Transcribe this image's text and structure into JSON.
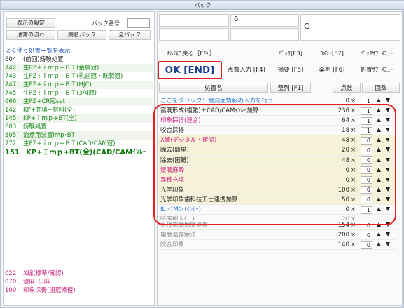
{
  "window": {
    "title": "パック"
  },
  "left": {
    "buttons": {
      "display_settings": "表示の設定",
      "pack_number_label": "パック番号",
      "normal_flow": "通常の流れ",
      "disease_pack": "病名パック",
      "all_pack": "全パック"
    },
    "list_header": "よく使う処置一覧を表示",
    "items": [
      {
        "code": "604",
        "label": "(前回)鋳験処置",
        "style": "black"
      },
      {
        "code": "742",
        "label": "生PZ+ｉｍｐ+ＢＴ(金属冠)",
        "style": "green"
      },
      {
        "code": "743",
        "label": "生PZ+ｉｍｐ+ＢＴ(乳歯冠・既製冠)",
        "style": "green"
      },
      {
        "code": "747",
        "label": "生PZ+ｉｍｐ+ＢＴ(HJC)",
        "style": "green"
      },
      {
        "code": "745",
        "label": "生PZ+ｉｍｐ+ＢＴ(3/4冠)",
        "style": "green"
      },
      {
        "code": "666",
        "label": "生PZ+CR冠set",
        "style": "green"
      },
      {
        "code": "142",
        "label": "KP+充填+材料(全)",
        "style": "green"
      },
      {
        "code": "145",
        "label": "KP+ｉｍｐ+BT(全)",
        "style": "green"
      },
      {
        "code": "603",
        "label": "鋳験処置",
        "style": "green"
      },
      {
        "code": "305",
        "label": "治療用装置imp･BT",
        "style": "green"
      },
      {
        "code": "772",
        "label": "生PZ+ｉｍｐ+ＢＴ(CAD/CAM冠)",
        "style": "green"
      },
      {
        "code": "151",
        "label": "KP+Ｉｍｐ+BT(全)(CAD/CAMｲﾝﾚｰ",
        "style": "big"
      }
    ],
    "lower_items": [
      {
        "code": "022",
        "label": "X線(標準/確認)"
      },
      {
        "code": "070",
        "label": "浸麻･伝麻"
      },
      {
        "code": "100",
        "label": "印象採得(歯冠修復)"
      }
    ]
  },
  "right": {
    "info": {
      "field_b": "6",
      "field_d": "C"
    },
    "commands": {
      "back": "ｶﾙﾃに戻る［F９］",
      "pack": "ﾊﾟｯｸ[F3]",
      "comment": "ｺﾒﾝﾄ[F7]",
      "pack_submenu": "ﾊﾟｯｸｻﾌﾞﾒﾆｭｰ",
      "ok": "OK [END]",
      "points_input": "点数入力 [F4]",
      "summary": "摘要 [F5]",
      "drug": "薬剤 [F6]",
      "treatment_submenu": "処置ｻﾌﾞﾒﾆｭｰ"
    },
    "columns": {
      "name": "処置名",
      "sort": "整列 [F1]",
      "points": "点数",
      "count": "回数"
    },
    "link_text": "ここをクリック：窩洞面情報の入力を行う",
    "link_row": {
      "points": "0",
      "x": "×",
      "qty": "1"
    },
    "items": [
      {
        "name": "窩洞形成(複雑)＋CAD/CAMｲﾝﾚｰ加算",
        "points": "236",
        "x": "×",
        "qty": "1",
        "color": "black"
      },
      {
        "name": "印象採得(連合)",
        "points": "64",
        "x": "×",
        "qty": "1",
        "color": "pink"
      },
      {
        "name": "咬合採得",
        "points": "18",
        "x": "×",
        "qty": "1",
        "color": "black"
      },
      {
        "name": "X線(デジタル・確認)",
        "points": "48",
        "x": "×",
        "qty": "0",
        "color": "pink"
      },
      {
        "name": "除去(簡単)",
        "points": "20",
        "x": "×",
        "qty": "0",
        "color": "black"
      },
      {
        "name": "除去(困難)",
        "points": "48",
        "x": "×",
        "qty": "0",
        "color": "black"
      },
      {
        "name": "浸潤麻酔",
        "points": "0",
        "x": "×",
        "qty": "0",
        "color": "pink"
      },
      {
        "name": "異種充填",
        "points": "0",
        "x": "×",
        "qty": "0",
        "color": "pink"
      },
      {
        "name": "光学印象",
        "points": "100",
        "x": "×",
        "qty": "0",
        "color": "black"
      },
      {
        "name": "光学印象歯科技工士連携加算",
        "points": "50",
        "x": "×",
        "qty": "0",
        "color": "black"
      },
      {
        "name": "IL ＜M＞(ｲﾝﾚｰ)",
        "points": "0",
        "x": "×",
        "qty": "1",
        "color": "blue"
      },
      {
        "name": "咬頭嵌入(...)",
        "points": "20",
        "x": "×",
        "qty": "0",
        "color": "gray"
      },
      {
        "name": "直接歯髄保護処置",
        "points": "154",
        "x": "×",
        "qty": "0",
        "color": "gray"
      },
      {
        "name": "歯髄温存療法",
        "points": "200",
        "x": "×",
        "qty": "0",
        "color": "gray"
      },
      {
        "name": "咬合印象",
        "points": "140",
        "x": "×",
        "qty": "0",
        "color": "gray"
      }
    ]
  }
}
